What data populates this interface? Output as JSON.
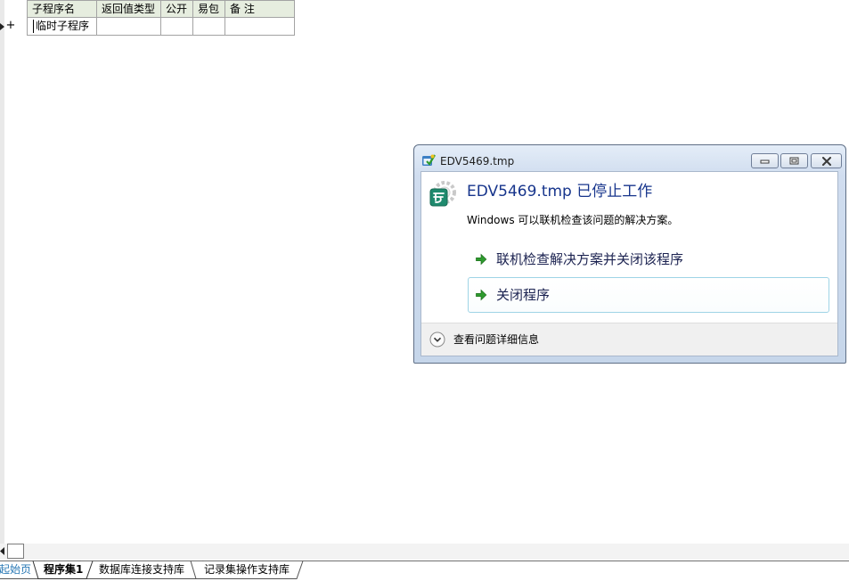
{
  "editor": {
    "row_marker": "+",
    "table": {
      "headers": [
        "子程序名",
        "返回值类型",
        "公开",
        "易包",
        "备 注"
      ],
      "rows": [
        [
          "临时子程序",
          "",
          "",
          "",
          ""
        ]
      ]
    }
  },
  "tabs": [
    {
      "label": "起始页",
      "active": false
    },
    {
      "label": "程序集1",
      "active": true
    },
    {
      "label": "数据库连接支持库",
      "active": false
    },
    {
      "label": "记录集操作支持库",
      "active": false
    }
  ],
  "dialog": {
    "title": "EDV5469.tmp",
    "heading": "EDV5469.tmp 已停止工作",
    "message": "Windows 可以联机检查该问题的解决方案。",
    "options": [
      {
        "label": "联机检查解决方案并关闭该程序",
        "icon": "green-arrow-icon"
      },
      {
        "label": "关闭程序",
        "icon": "green-arrow-icon"
      }
    ],
    "details_label": "查看问题详细信息",
    "details_icon": "chevron-down-circle-icon",
    "title_buttons": [
      "minimize-icon",
      "maximize-icon",
      "close-icon"
    ]
  },
  "colors": {
    "heading": "#17358c",
    "start_tab_text": "#2878b5",
    "table_header_bg": "#e6eddf",
    "highlighted_option_border": "#9fd4e6",
    "arrow_green": "#2e9b2e"
  }
}
